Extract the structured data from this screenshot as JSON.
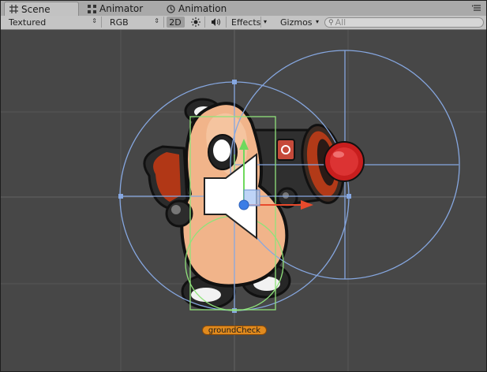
{
  "tabs": [
    {
      "label": "Scene",
      "icon": "scene-grid-icon",
      "active": true
    },
    {
      "label": "Animator",
      "icon": "animator-icon",
      "active": false
    },
    {
      "label": "Animation",
      "icon": "animation-icon",
      "active": false
    }
  ],
  "toolbar": {
    "render_mode": "Textured",
    "color_mode": "RGB",
    "mode_2d": "2D",
    "lighting_icon": "sun-icon",
    "audio_icon": "speaker-icon",
    "effects": "Effects",
    "gizmos": "Gizmos",
    "search_placeholder": "All"
  },
  "scene": {
    "selected_object_label": "groundCheck",
    "colors": {
      "background": "#474747",
      "gizmo_blue": "#86a7e0",
      "collider_green": "#8fe27a",
      "handle_red": "#d42a2a",
      "label_orange": "#e08a1e"
    }
  }
}
